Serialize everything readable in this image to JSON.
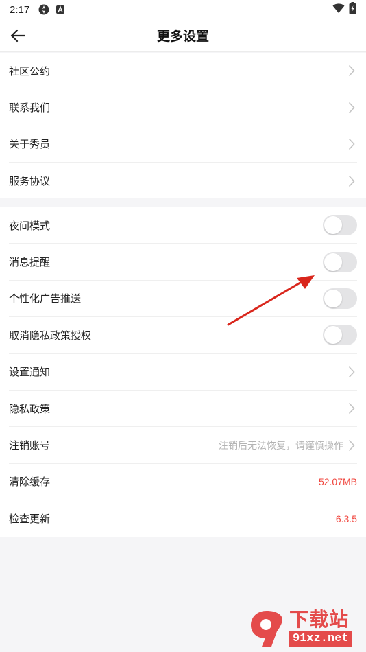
{
  "status_bar": {
    "time": "2:17"
  },
  "header": {
    "title": "更多设置"
  },
  "group1": [
    {
      "label": "社区公约"
    },
    {
      "label": "联系我们"
    },
    {
      "label": "关于秀员"
    },
    {
      "label": "服务协议"
    }
  ],
  "group2": {
    "toggles": [
      {
        "label": "夜间模式",
        "on": false
      },
      {
        "label": "消息提醒",
        "on": false
      },
      {
        "label": "个性化广告推送",
        "on": false
      },
      {
        "label": "取消隐私政策授权",
        "on": false
      }
    ],
    "settings_notice": {
      "label": "设置通知"
    },
    "privacy_policy": {
      "label": "隐私政策"
    },
    "cancel_account": {
      "label": "注销账号",
      "hint": "注销后无法恢复，请谨慎操作"
    },
    "clear_cache": {
      "label": "清除缓存",
      "value": "52.07MB"
    },
    "check_update": {
      "label": "检查更新",
      "value": "6.3.5"
    }
  },
  "watermark": {
    "brand_top": "下载站",
    "brand_bottom": "91xz.net"
  },
  "colors": {
    "accent_red": "#f0443c",
    "annotation_arrow": "#d9261c",
    "toggle_off": "#e4e4e6"
  }
}
